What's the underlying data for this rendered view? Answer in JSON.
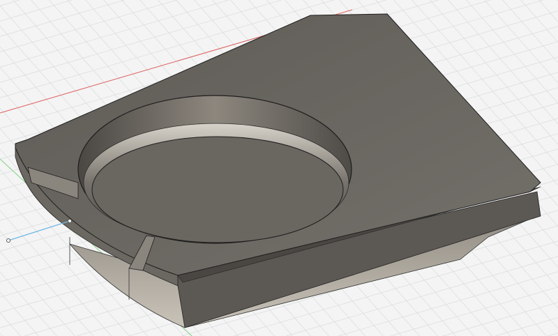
{
  "viewport": {
    "background": "#f4f4f4",
    "grid_color": "#d9dbdd",
    "axis_x_color": "#e06060",
    "axis_y_color": "#7fcf7f",
    "axis_z_color": "#6fb7e6",
    "model_top_color": "#6e6a64",
    "model_side_color": "#5a5752",
    "model_bottom_color": "#b2aca2",
    "edge_color": "#1e1e1e"
  }
}
